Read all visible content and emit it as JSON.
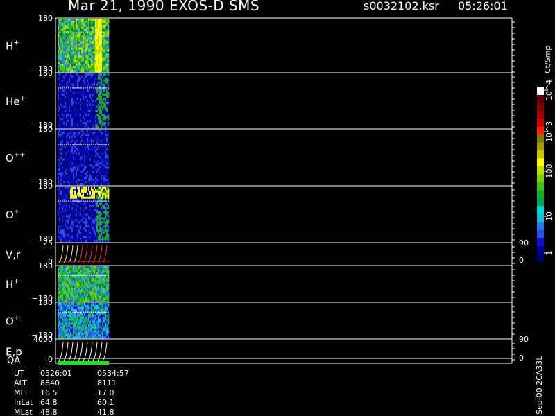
{
  "header": {
    "title": "Mar 21, 1990   EXOS-D SMS",
    "file": "s0032102.ksr",
    "time": "05:26:01"
  },
  "chart_data": {
    "type": "heatmap",
    "colorbar": {
      "label": "Ct/Smp",
      "scale": "log",
      "ticks": [
        "1",
        "10",
        "100",
        "10^3",
        "10^4"
      ],
      "colors": [
        "#000070",
        "#00009a",
        "#1010c8",
        "#2550e0",
        "#2a78f0",
        "#20b8d8",
        "#00d8d0",
        "#00a060",
        "#10b020",
        "#40c020",
        "#80d000",
        "#c0e000",
        "#ffff00",
        "#d0c000",
        "#a0a000",
        "#808000",
        "#ff2000",
        "#d00000",
        "#a00000",
        "#800000",
        "#600000",
        "#ffffff"
      ]
    },
    "panels": [
      {
        "label": "H",
        "sup": "+",
        "ymax": "180",
        "ymin": "−180",
        "kind": "H1"
      },
      {
        "label": "He",
        "sup": "+",
        "ymax": "180",
        "ymin": "−180",
        "kind": "He"
      },
      {
        "label": "O",
        "sup": "++",
        "ymax": "180",
        "ymin": "−180",
        "kind": "O2"
      },
      {
        "label": "O",
        "sup": "+",
        "ymax": "180",
        "ymin": "−180",
        "kind": "O1"
      },
      {
        "label": "V,r",
        "sup": "",
        "ymax": "25",
        "ymin": "0",
        "right_top": "90",
        "right_bottom": "0",
        "kind": "line"
      },
      {
        "label": "H",
        "sup": "+",
        "ymax": "180",
        "ymin": "−180",
        "kind": "H2"
      },
      {
        "label": "O",
        "sup": "+",
        "ymax": "180",
        "ymin": "−180",
        "kind": "O3"
      },
      {
        "label": "E,p",
        "sup": "",
        "ymax": "4000",
        "ymin": "0",
        "right_top": "90",
        "right_bottom": "0",
        "kind": "line2"
      }
    ],
    "qa_label": "QA",
    "time_axis": {
      "rows": [
        {
          "name": "UT",
          "start": "0526:01",
          "end": "0534:57"
        },
        {
          "name": "ALT",
          "start": "8840",
          "end": "8111"
        },
        {
          "name": "MLT",
          "start": "16.5",
          "end": "17.0"
        },
        {
          "name": "InLat",
          "start": "64.8",
          "end": "60.1"
        },
        {
          "name": "MLat",
          "start": "48.8",
          "end": "41.8"
        }
      ]
    }
  },
  "side_note": "Sep-00  2CA33L"
}
